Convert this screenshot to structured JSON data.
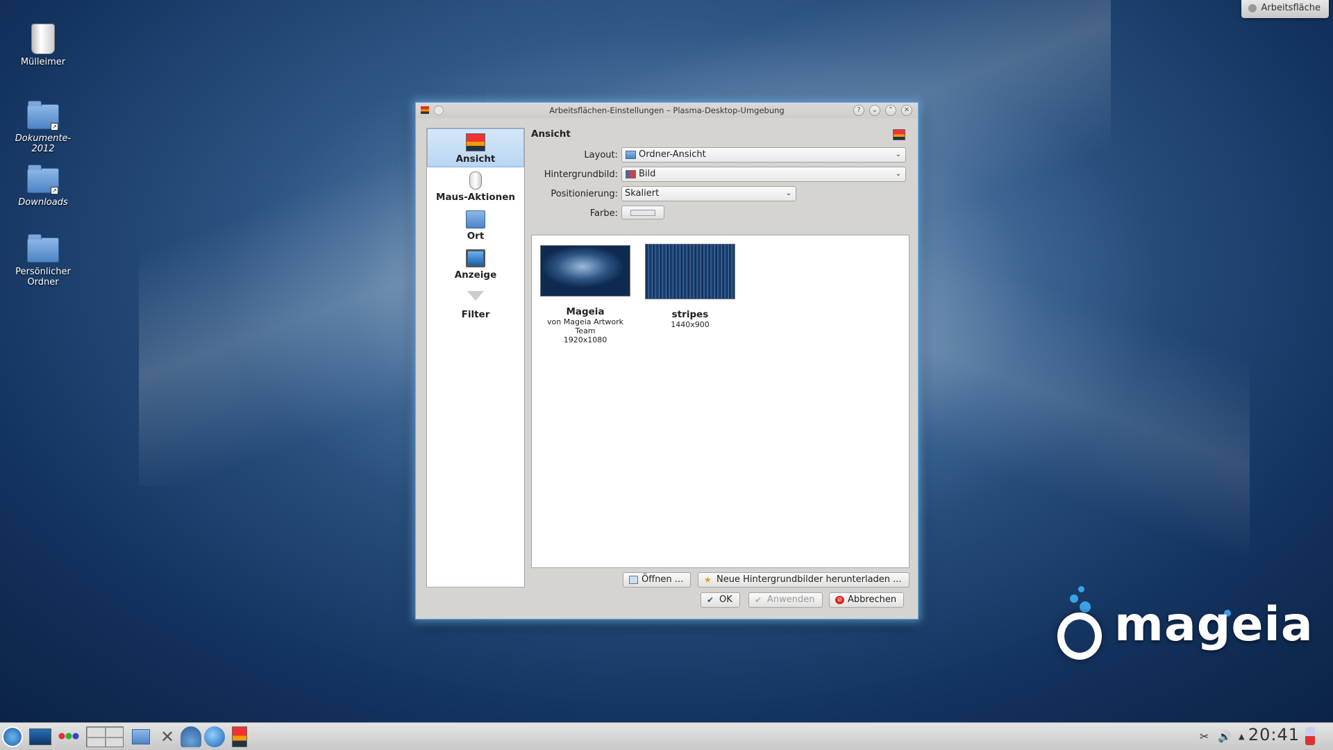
{
  "desktop": {
    "icons": [
      {
        "label": "Mülleimer",
        "icon": "trash-icon"
      },
      {
        "label": "Dokumente-\n2012",
        "icon": "folder-icon"
      },
      {
        "label": "Downloads",
        "icon": "folder-icon"
      },
      {
        "label": "Persönlicher\nOrdner",
        "icon": "home-folder-icon"
      }
    ],
    "toolbox_label": "Arbeitsfläche",
    "logo_text": "mageia"
  },
  "window": {
    "title": "Arbeitsflächen-Einstellungen – Plasma-Desktop-Umgebung",
    "sidebar": [
      {
        "label": "Ansicht",
        "icon": "wallpaper-icon",
        "active": true
      },
      {
        "label": "Maus-Aktionen",
        "icon": "mouse-icon",
        "active": false
      },
      {
        "label": "Ort",
        "icon": "folder-icon",
        "active": false
      },
      {
        "label": "Anzeige",
        "icon": "display-icon",
        "active": false
      },
      {
        "label": "Filter",
        "icon": "filter-icon",
        "active": false
      }
    ],
    "heading": "Ansicht",
    "form": {
      "layout_label": "Layout:",
      "layout_value": "Ordner-Ansicht",
      "wallpaper_label": "Hintergrundbild:",
      "wallpaper_value": "Bild",
      "position_label": "Positionierung:",
      "position_value": "Skaliert",
      "color_label": "Farbe:"
    },
    "wallpapers": [
      {
        "name": "Mageia",
        "author_line1": "von Mageia Artwork",
        "author_line2": "Team",
        "size": "1920x1080"
      },
      {
        "name": "stripes",
        "size": "1440x900"
      }
    ],
    "buttons": {
      "open": "Öffnen ...",
      "download": "Neue Hintergrundbilder herunterladen ...",
      "ok": "OK",
      "apply": "Anwenden",
      "cancel": "Abbrechen"
    }
  },
  "taskbar": {
    "clock": "20:41"
  },
  "colors": {
    "accent": "#86b4e0",
    "window_bg": "#d6d4d1",
    "desktop_dark": "#13325e"
  }
}
